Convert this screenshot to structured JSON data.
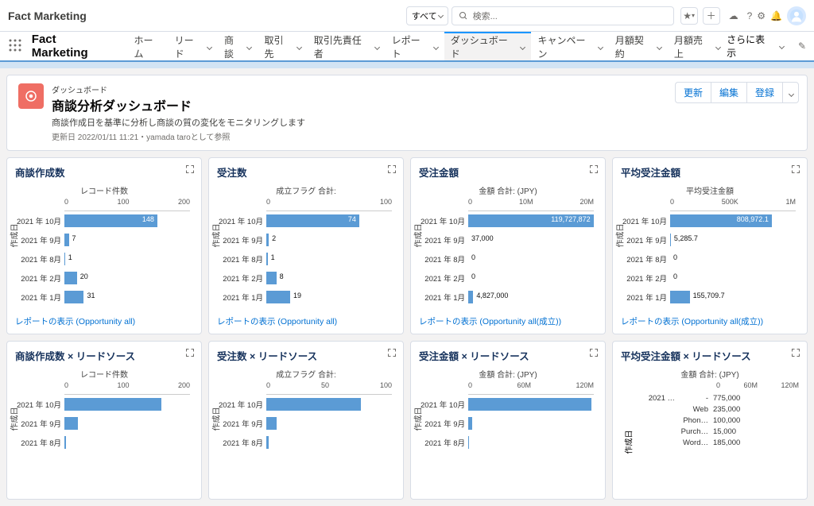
{
  "app": {
    "org_title": "Fact Marketing",
    "app_name": "Fact Marketing",
    "search": {
      "scope": "すべて",
      "placeholder": "検索..."
    }
  },
  "nav": {
    "tabs": [
      "ホーム",
      "リード",
      "商談",
      "取引先",
      "取引先責任者",
      "レポート",
      "ダッシュボード",
      "キャンペーン",
      "月額契約",
      "月額売上"
    ],
    "active": 6,
    "more": "さらに表示"
  },
  "page": {
    "eyebrow": "ダッシュボード",
    "title": "商談分析ダッシュボード",
    "desc": "商談作成日を基準に分析し商談の質の変化をモニタリングします",
    "meta": "更新日 2022/01/11 11:21・yamada taroとして参照",
    "actions": {
      "refresh": "更新",
      "edit": "編集",
      "save": "登録"
    }
  },
  "cards": [
    {
      "title": "商談作成数",
      "axis_title": "レコード件数",
      "y_label": "作成日",
      "link": "レポートの表示 (Opportunity all)",
      "chart_data": {
        "type": "bar",
        "ticks": [
          "0",
          "100",
          "200"
        ],
        "categories": [
          "2021 年 10月",
          "2021 年 9月",
          "2021 年 8月",
          "2021 年 2月",
          "2021 年 1月"
        ],
        "values": [
          148,
          7,
          1,
          20,
          31
        ],
        "max": 200
      }
    },
    {
      "title": "受注数",
      "axis_title": "成立フラグ 合計:",
      "y_label": "作成日",
      "link": "レポートの表示 (Opportunity all)",
      "chart_data": {
        "type": "bar",
        "ticks": [
          "0",
          "100"
        ],
        "categories": [
          "2021 年 10月",
          "2021 年 9月",
          "2021 年 8月",
          "2021 年 2月",
          "2021 年 1月"
        ],
        "values": [
          74,
          2,
          1,
          8,
          19
        ],
        "max": 100
      }
    },
    {
      "title": "受注金額",
      "axis_title": "金額 合計: (JPY)",
      "y_label": "作成日",
      "link": "レポートの表示 (Opportunity all(成立))",
      "chart_data": {
        "type": "bar",
        "ticks": [
          "0",
          "10M",
          "20M"
        ],
        "categories": [
          "2021 年 10月",
          "2021 年 9月",
          "2021 年 8月",
          "2021 年 2月",
          "2021 年 1月"
        ],
        "values": [
          119727872,
          37000,
          0,
          0,
          4827000
        ],
        "labels": [
          "119,727,872",
          "37,000",
          "0",
          "0",
          "4,827,000"
        ],
        "max": 120000000
      }
    },
    {
      "title": "平均受注金額",
      "axis_title": "平均受注金額",
      "y_label": "作成日",
      "link": "レポートの表示 (Opportunity all(成立))",
      "chart_data": {
        "type": "bar",
        "ticks": [
          "0",
          "500K",
          "1M"
        ],
        "categories": [
          "2021 年 10月",
          "2021 年 9月",
          "2021 年 8月",
          "2021 年 2月",
          "2021 年 1月"
        ],
        "values": [
          808972.1,
          5285.7,
          0,
          0,
          155709.7
        ],
        "labels": [
          "808,972.1",
          "5,285.7",
          "0",
          "0",
          "155,709.7"
        ],
        "max": 1000000
      }
    },
    {
      "title": "商談作成数 × リードソース",
      "axis_title": "レコード件数",
      "y_label": "作成日",
      "chart_data": {
        "type": "bar",
        "ticks": [
          "0",
          "100",
          "200"
        ],
        "categories": [
          "2021 年 10月",
          "2021 年 9月",
          "2021 年 8月"
        ],
        "values": [
          155,
          22,
          3
        ],
        "max": 200,
        "hide_vals": true
      }
    },
    {
      "title": "受注数 × リードソース",
      "axis_title": "成立フラグ 合計:",
      "y_label": "作成日",
      "chart_data": {
        "type": "bar",
        "ticks": [
          "0",
          "50",
          "100"
        ],
        "categories": [
          "2021 年 10月",
          "2021 年 9月",
          "2021 年 8月"
        ],
        "values": [
          75,
          8,
          2
        ],
        "max": 100,
        "hide_vals": true
      }
    },
    {
      "title": "受注金額 × リードソース",
      "axis_title": "金額 合計: (JPY)",
      "y_label": "作成日",
      "chart_data": {
        "type": "bar",
        "ticks": [
          "0",
          "60M",
          "120M"
        ],
        "categories": [
          "2021 年 10月",
          "2021 年 9月",
          "2021 年 8月"
        ],
        "values": [
          118000000,
          4000000,
          500000
        ],
        "max": 120000000,
        "hide_vals": true
      }
    },
    {
      "title": "平均受注金額 × リードソース",
      "axis_title": "金額 合計: (JPY)",
      "y_label": "作成日",
      "chart_data": {
        "type": "table",
        "ticks": [
          "0",
          "60M",
          "120M"
        ],
        "category": "2021 …",
        "groups": [
          "-",
          "Web",
          "Phon…",
          "Purch…",
          "Word…"
        ],
        "values": [
          "775,000",
          "235,000",
          "100,000",
          "15,000",
          "185,000"
        ]
      }
    }
  ]
}
